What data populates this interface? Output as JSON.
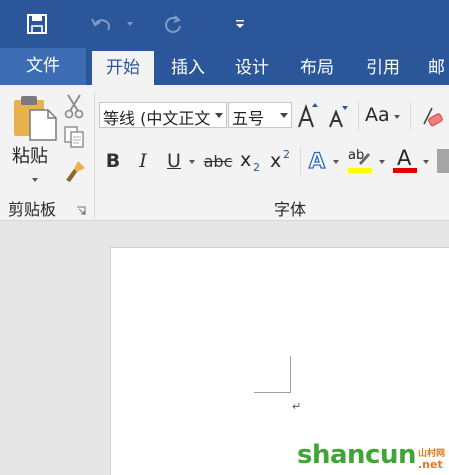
{
  "tabs": [
    {
      "label": "文件"
    },
    {
      "label": "开始"
    },
    {
      "label": "插入"
    },
    {
      "label": "设计"
    },
    {
      "label": "布局"
    },
    {
      "label": "引用"
    },
    {
      "label": "邮"
    }
  ],
  "clipboard": {
    "paste_label": "粘贴",
    "group_label": "剪贴板"
  },
  "font": {
    "font_name": "等线 (中文正文",
    "font_size": "五号",
    "change_case_label": "Aa",
    "bold": "B",
    "italic": "I",
    "underline": "U",
    "strikethrough": "abc",
    "subscript_base": "x",
    "subscript_mark": "2",
    "superscript_base": "x",
    "superscript_mark": "2",
    "text_effects": "A",
    "highlight": "ab",
    "font_color": "A",
    "group_label": "字体"
  },
  "document": {
    "paragraph_mark": "↵"
  },
  "watermark": {
    "text": "shancun",
    "suffix": ".net",
    "site_cn": "山村网"
  },
  "colors": {
    "title_bar": "#2b579a",
    "ribbon": "#f3f3f3",
    "highlight_yellow": "#ffff00",
    "font_red": "#e00000",
    "watermark_green": "#3fa535"
  }
}
